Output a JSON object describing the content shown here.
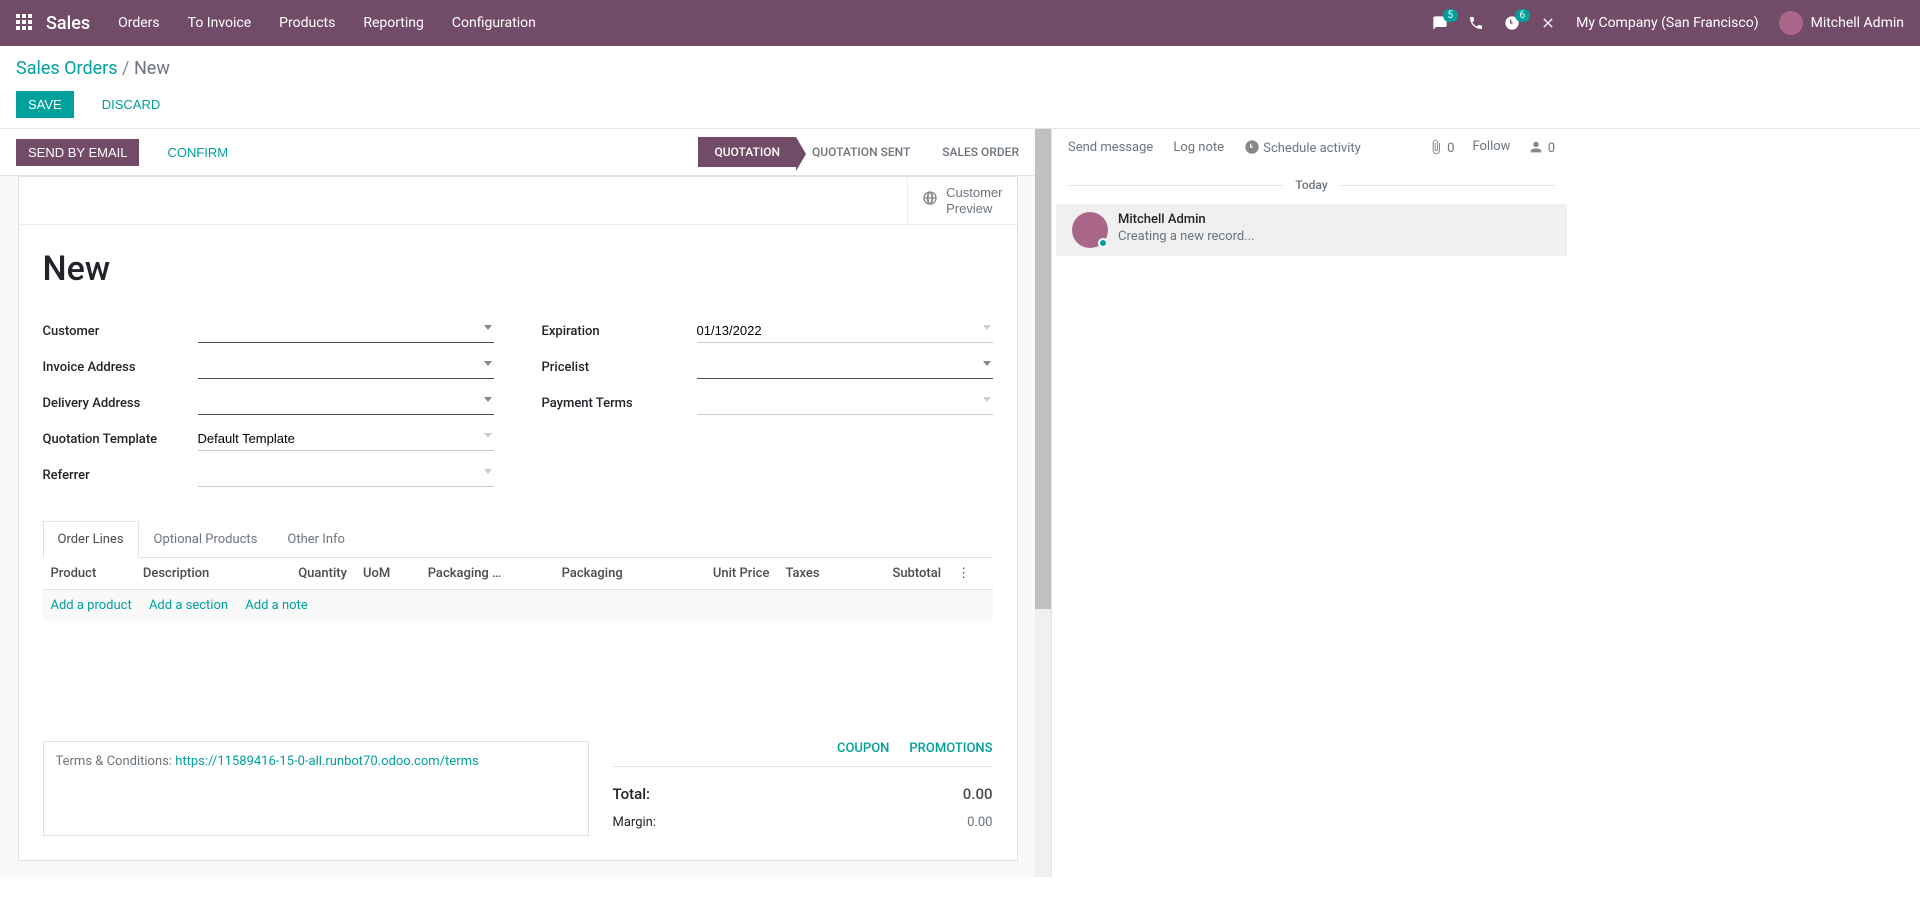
{
  "topnav": {
    "brand": "Sales",
    "menu": [
      "Orders",
      "To Invoice",
      "Products",
      "Reporting",
      "Configuration"
    ],
    "chat_badge": "5",
    "activity_badge": "6",
    "company": "My Company (San Francisco)",
    "user": "Mitchell Admin"
  },
  "breadcrumb": {
    "parent": "Sales Orders",
    "current": "New"
  },
  "cp": {
    "save": "SAVE",
    "discard": "DISCARD"
  },
  "statusbar": {
    "send": "SEND BY EMAIL",
    "confirm": "CONFIRM",
    "stages": [
      "QUOTATION",
      "QUOTATION SENT",
      "SALES ORDER"
    ]
  },
  "button_box": {
    "preview_l1": "Customer",
    "preview_l2": "Preview"
  },
  "title": "New",
  "fields_left": [
    {
      "label": "Customer",
      "value": "",
      "required": true,
      "caret": true
    },
    {
      "label": "Invoice Address",
      "value": "",
      "required": true,
      "caret": true
    },
    {
      "label": "Delivery Address",
      "value": "",
      "required": true,
      "caret": true
    },
    {
      "label": "Quotation Template",
      "value": "Default Template",
      "required": false,
      "caret": true
    },
    {
      "label": "Referrer",
      "value": "",
      "required": false,
      "caret": true
    }
  ],
  "fields_right": [
    {
      "label": "Expiration",
      "value": "01/13/2022",
      "required": false,
      "caret": false
    },
    {
      "label": "Pricelist",
      "value": "",
      "required": true,
      "caret": true
    },
    {
      "label": "Payment Terms",
      "value": "",
      "required": false,
      "caret": true
    }
  ],
  "tabs": [
    "Order Lines",
    "Optional Products",
    "Other Info"
  ],
  "table": {
    "headers": [
      "Product",
      "Description",
      "Quantity",
      "UoM",
      "Packaging …",
      "Packaging",
      "Unit Price",
      "Taxes",
      "Subtotal"
    ],
    "add_product": "Add a product",
    "add_section": "Add a section",
    "add_note": "Add a note"
  },
  "promos": {
    "coupon": "COUPON",
    "promotions": "PROMOTIONS"
  },
  "terms": {
    "prefix": "Terms & Conditions: ",
    "link": "https://11589416-15-0-all.runbot70.odoo.com/terms"
  },
  "totals": {
    "total_label": "Total:",
    "total_value": "0.00",
    "margin_label": "Margin:",
    "margin_value": "0.00"
  },
  "chatter": {
    "send": "Send message",
    "log": "Log note",
    "schedule": "Schedule activity",
    "attach_count": "0",
    "follow": "Follow",
    "follower_count": "0",
    "today": "Today",
    "msg_author": "Mitchell Admin",
    "msg_body": "Creating a new record..."
  }
}
